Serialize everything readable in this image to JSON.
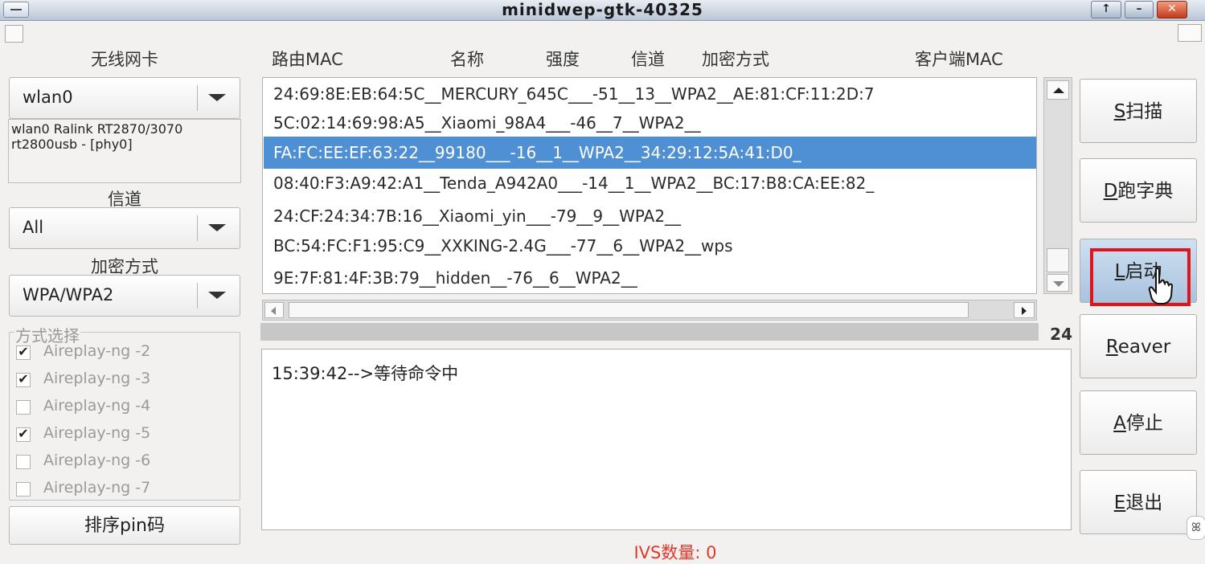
{
  "window": {
    "title": "minidwep-gtk-40325",
    "controls": [
      "↑",
      "–",
      "✕"
    ]
  },
  "left": {
    "card_label": "无线网卡",
    "card_value": "wlan0",
    "card_info": "wlan0 Ralink RT2870/3070 rt2800usb - [phy0]",
    "channel_label": "信道",
    "channel_value": "All",
    "enc_label": "加密方式",
    "enc_value": "WPA/WPA2",
    "method_legend": "方式选择",
    "methods": [
      {
        "label": "Aireplay-ng -2",
        "checked": true,
        "mark": "✔"
      },
      {
        "label": "Aireplay-ng -3",
        "checked": true,
        "mark": "✔"
      },
      {
        "label": "Aireplay-ng -4",
        "checked": false,
        "mark": ""
      },
      {
        "label": "Aireplay-ng -5",
        "checked": true,
        "mark": "✔"
      },
      {
        "label": "Aireplay-ng -6",
        "checked": false,
        "mark": ""
      },
      {
        "label": "Aireplay-ng -7",
        "checked": false,
        "mark": ""
      }
    ],
    "pin_button": "排序pin码"
  },
  "headers": [
    "路由MAC",
    "名称",
    "强度",
    "信道",
    "加密方式",
    "客户端MAC"
  ],
  "ap_rows": [
    "24:69:8E:EB:64:5C__MERCURY_645C___-51__13__WPA2__AE:81:CF:11:2D:7",
    "5C:02:14:69:98:A5__Xiaomi_98A4___-46__7__WPA2__",
    "FA:FC:EE:EF:63:22__99180___-16__1__WPA2__34:29:12:5A:41:D0_",
    "08:40:F3:A9:42:A1__Tenda_A942A0___-14__1__WPA2__BC:17:B8:CA:EE:82_",
    "24:CF:24:34:7B:16__Xiaomi_yin___-79__9__WPA2__",
    "BC:54:FC:F1:95:C9__XXKING-2.4G___-77__6__WPA2__wps",
    "9E:7F:81:4F:3B:79__hidden__-76__6__WPA2__"
  ],
  "selected_row": 2,
  "progress_count": "24",
  "log": "15:39:42-->等待命令中",
  "ivs": "IVS数量: 0",
  "actions": [
    {
      "key": "S",
      "rest": "扫描"
    },
    {
      "key": "D",
      "rest": "跑字典"
    },
    {
      "key": "L",
      "rest": "启动"
    },
    {
      "key": "R",
      "rest": "eaver"
    },
    {
      "key": "A",
      "rest": "停止"
    },
    {
      "key": "E",
      "rest": "退出"
    }
  ],
  "colors": {
    "selection": "#4f8fd3",
    "highlight_box": "#e0141c",
    "ivs_text": "#e0392a"
  }
}
